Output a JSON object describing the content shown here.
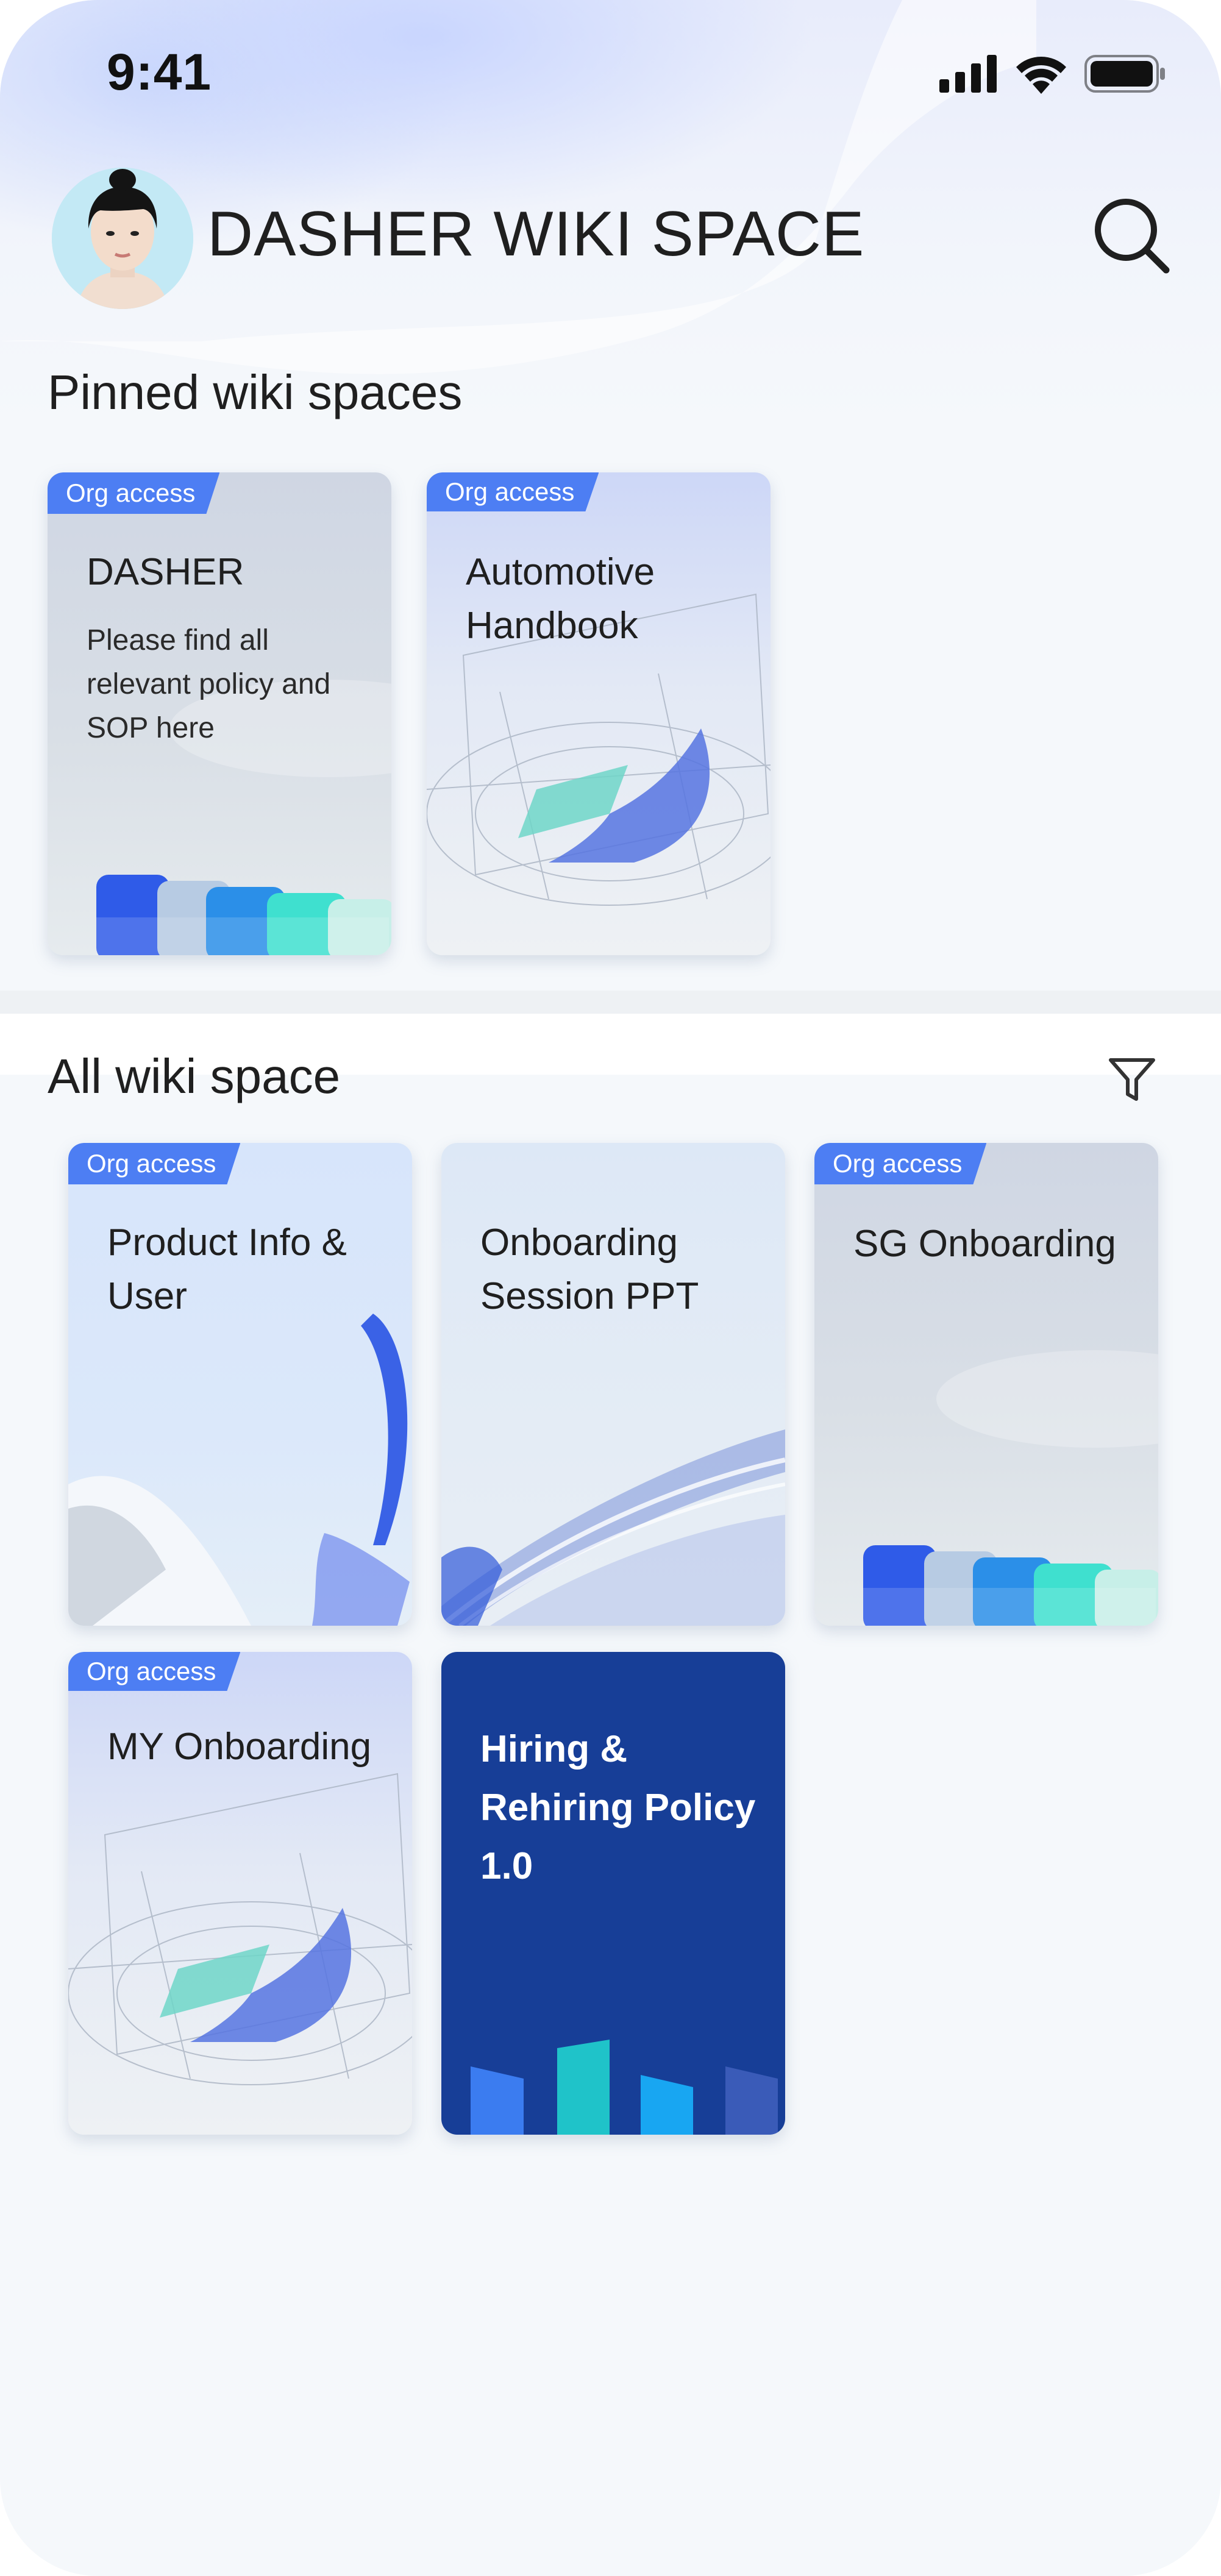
{
  "status_bar": {
    "time": "9:41"
  },
  "header": {
    "title": "DASHER WIKI SPACE"
  },
  "pinned": {
    "title": "Pinned wiki spaces",
    "cards": [
      {
        "badge": "Org access",
        "title": "DASHER",
        "description": "Please find all relevant policy and SOP here"
      },
      {
        "badge": "Org access",
        "title": "Automotive Handbook"
      }
    ]
  },
  "all": {
    "title": "All wiki space",
    "cards": [
      {
        "badge": "Org access",
        "title": "Product Info & User"
      },
      {
        "title": "Onboarding Session PPT"
      },
      {
        "badge": "Org access",
        "title": "SG Onboarding"
      },
      {
        "badge": "Org access",
        "title": "MY Onboarding"
      },
      {
        "title": "Hiring & Rehiring Policy 1.0"
      }
    ]
  },
  "colors": {
    "accent": "#4d7ef3",
    "featured_card": "#173e97",
    "background": "#f5f8fb"
  }
}
